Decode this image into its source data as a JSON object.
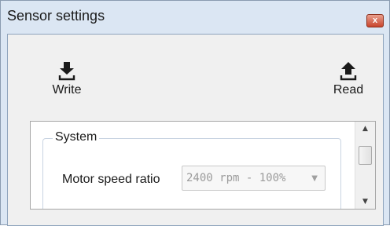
{
  "window": {
    "title": "Sensor settings",
    "close_glyph": "x"
  },
  "toolbar": {
    "write_label": "Write",
    "write_icon": "download-icon",
    "read_label": "Read",
    "read_icon": "upload-icon"
  },
  "system_group": {
    "title": "System",
    "motor_speed_ratio": {
      "label": "Motor speed ratio",
      "value": "2400 rpm - 100%",
      "enabled": false
    }
  },
  "scrollbar": {
    "up_glyph": "▲",
    "down_glyph": "▼"
  }
}
